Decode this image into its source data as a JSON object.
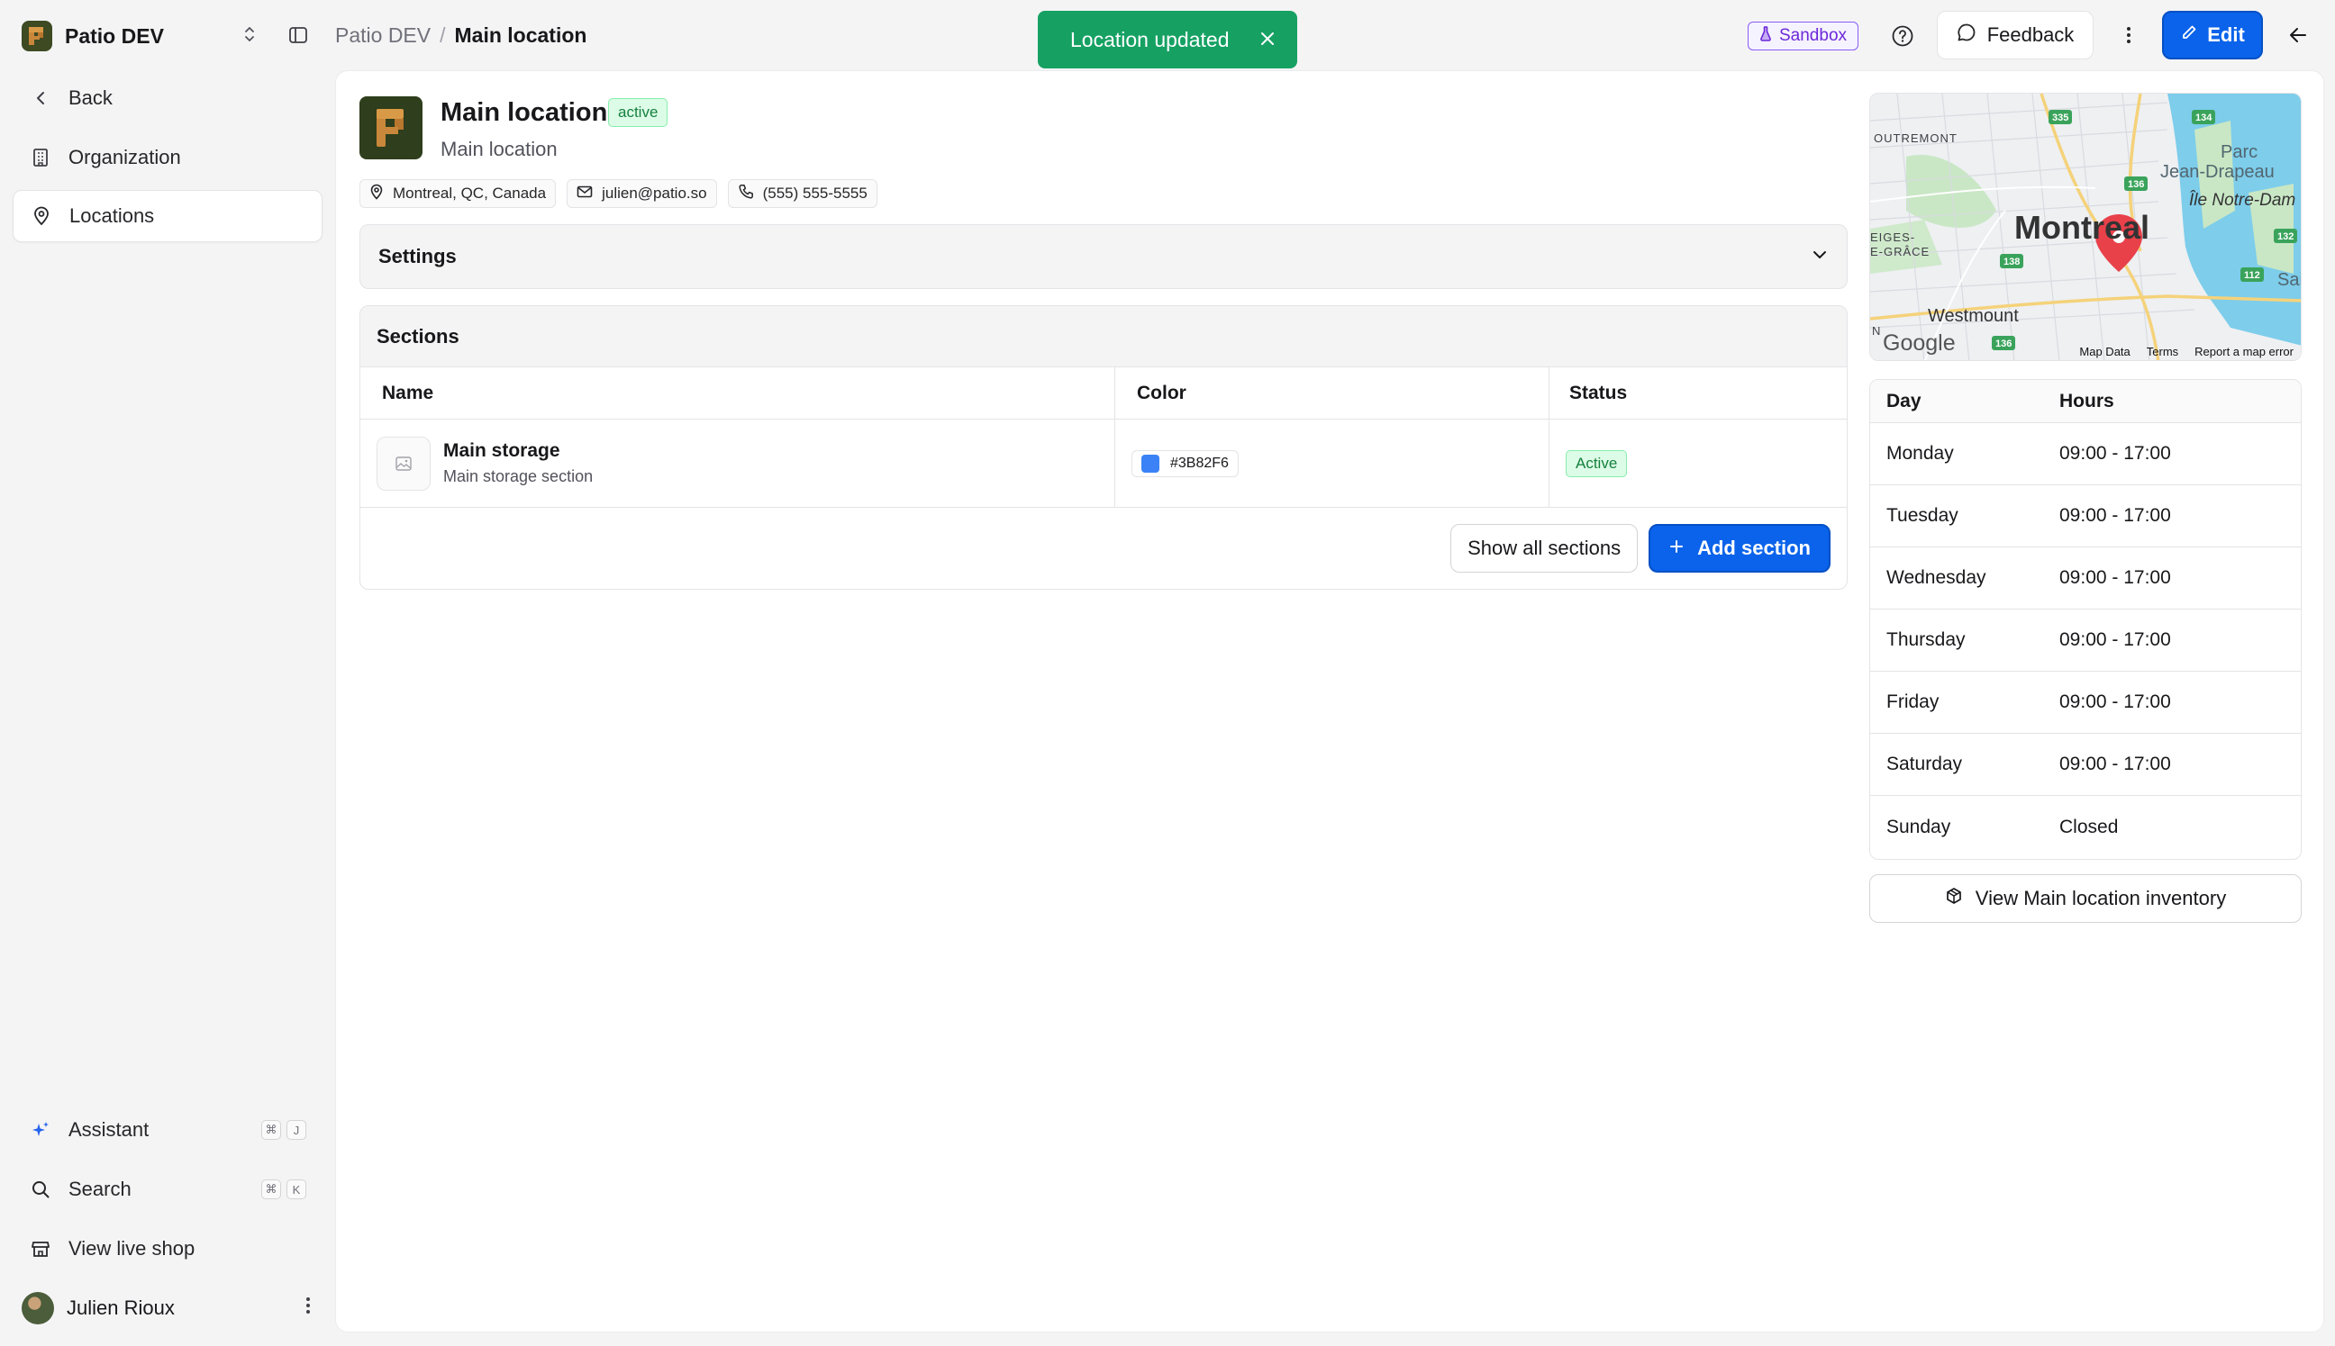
{
  "sidebar": {
    "org_name": "Patio DEV",
    "nav": {
      "back": "Back",
      "organization": "Organization",
      "locations": "Locations"
    },
    "bottom": {
      "assistant": "Assistant",
      "assistant_keys": [
        "⌘",
        "J"
      ],
      "search": "Search",
      "search_keys": [
        "⌘",
        "K"
      ],
      "live_shop": "View live shop"
    },
    "user_name": "Julien Rioux"
  },
  "header": {
    "breadcrumb_root": "Patio DEV",
    "breadcrumb_sep": "/",
    "breadcrumb_current": "Main location",
    "toast": "Location updated",
    "sandbox_label": "Sandbox",
    "feedback_label": "Feedback",
    "edit_label": "Edit"
  },
  "location": {
    "name": "Main location",
    "status": "active",
    "description": "Main location",
    "address": "Montreal, QC, Canada",
    "email": "julien@patio.so",
    "phone": "(555) 555-5555"
  },
  "settings": {
    "label": "Settings"
  },
  "sections": {
    "title": "Sections",
    "columns": [
      "Name",
      "Color",
      "Status"
    ],
    "rows": [
      {
        "name": "Main storage",
        "description": "Main storage section",
        "color": "#3B82F6",
        "status": "Active"
      }
    ],
    "show_all_label": "Show all sections",
    "add_label": "Add section"
  },
  "map": {
    "labels": {
      "city": "Montreal",
      "outremont": "OUTREMONT",
      "parc": "Parc",
      "jean_drapeau": "Jean-Drapeau",
      "ile": "Île Notre-Dam",
      "ndg_1": "EIGES-",
      "ndg_2": "E-GRÂCE",
      "westmount": "Westmount",
      "sai": "Sai",
      "n": "N"
    },
    "route_numbers": [
      "335",
      "134",
      "136",
      "138",
      "132",
      "112",
      "136"
    ],
    "google": "Google",
    "footer": [
      "Map Data",
      "Terms",
      "Report a map error"
    ]
  },
  "hours": {
    "columns": [
      "Day",
      "Hours"
    ],
    "rows": [
      {
        "day": "Monday",
        "hours": "09:00 - 17:00"
      },
      {
        "day": "Tuesday",
        "hours": "09:00 - 17:00"
      },
      {
        "day": "Wednesday",
        "hours": "09:00 - 17:00"
      },
      {
        "day": "Thursday",
        "hours": "09:00 - 17:00"
      },
      {
        "day": "Friday",
        "hours": "09:00 - 17:00"
      },
      {
        "day": "Saturday",
        "hours": "09:00 - 17:00"
      },
      {
        "day": "Sunday",
        "hours": "Closed"
      }
    ],
    "inventory_label": "View Main location inventory"
  },
  "colors": {
    "primary": "#0A63EA",
    "toast": "#16A163",
    "active_bg": "#DCFCE7",
    "active_text": "#15803D",
    "sandbox": "#6D28D9",
    "map_pin": "#E8414A",
    "water": "#62C3E8"
  }
}
